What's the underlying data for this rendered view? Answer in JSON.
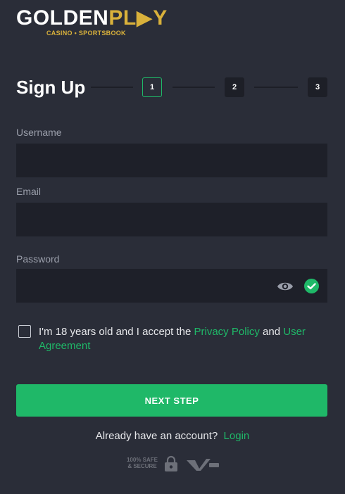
{
  "logo": {
    "brand_a": "GOLDEN",
    "brand_b": "PL▶Y",
    "tagline": "CASINO • SPORTSBOOK"
  },
  "signup": {
    "title": "Sign Up",
    "steps": [
      "1",
      "2",
      "3"
    ],
    "active_step": 1
  },
  "form": {
    "username_label": "Username",
    "email_label": "Email",
    "password_label": "Password",
    "username_value": "",
    "email_value": "",
    "password_value": ""
  },
  "agreement": {
    "text_before": "I'm 18 years old and I accept the ",
    "privacy_link": "Privacy Policy",
    "text_middle": " and ",
    "agreement_link": "User Agreement"
  },
  "actions": {
    "next_label": "NEXT STEP",
    "login_prompt": "Already have an account?",
    "login_link": "Login"
  },
  "badges": {
    "safe_text": "100% SAFE & SECURE"
  },
  "colors": {
    "background": "#2a2d38",
    "input": "#1e2029",
    "accent_green": "#1fb868",
    "brand_gold": "#d9b13b"
  }
}
